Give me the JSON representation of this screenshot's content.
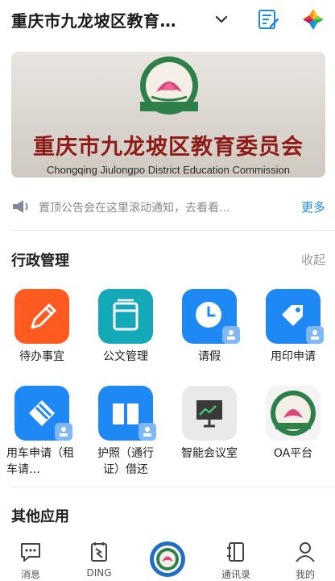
{
  "header": {
    "title": "重庆市九龙坡区教育…",
    "dropdown_icon": "chevron-down-icon",
    "actions": [
      "edit-list-icon",
      "colorful-logo-icon"
    ]
  },
  "banner": {
    "title": "重庆市九龙坡区教育委员会",
    "subtitle": "Chongqing Jiulongpo District Education Commission"
  },
  "notice": {
    "text": "置顶公告会在这里滚动通知，去看看...",
    "more_label": "更多"
  },
  "admin_section": {
    "title": "行政管理",
    "action_label": "收起",
    "apps": [
      {
        "label": "待办事宜",
        "icon": "pencil-icon",
        "color": "#ff5a1f"
      },
      {
        "label": "公文管理",
        "icon": "document-stack-icon",
        "color": "#13a9b8"
      },
      {
        "label": "请假",
        "icon": "clock-icon",
        "color": "#1e88f5"
      },
      {
        "label": "用印申请",
        "icon": "tag-icon",
        "color": "#1e88f5"
      },
      {
        "label": "用车申请（租车请…",
        "icon": "car-ticket-icon",
        "color": "#1e88f5"
      },
      {
        "label": "护照（通行证）借还",
        "icon": "book-icon",
        "color": "#1e88f5"
      },
      {
        "label": "智能会议室",
        "icon": "presentation-board-icon",
        "color": "#e9e9e9"
      },
      {
        "label": "OA平台",
        "icon": "org-emblem-icon",
        "color": "#f4f4f4"
      }
    ]
  },
  "other_section": {
    "title": "其他应用"
  },
  "bottom_nav": {
    "items": [
      {
        "label": "消息",
        "icon": "message-icon"
      },
      {
        "label": "DING",
        "icon": "ding-icon"
      },
      {
        "label": "",
        "icon": "org-emblem-icon"
      },
      {
        "label": "通讯录",
        "icon": "contacts-icon"
      },
      {
        "label": "我的",
        "icon": "person-icon"
      }
    ]
  }
}
